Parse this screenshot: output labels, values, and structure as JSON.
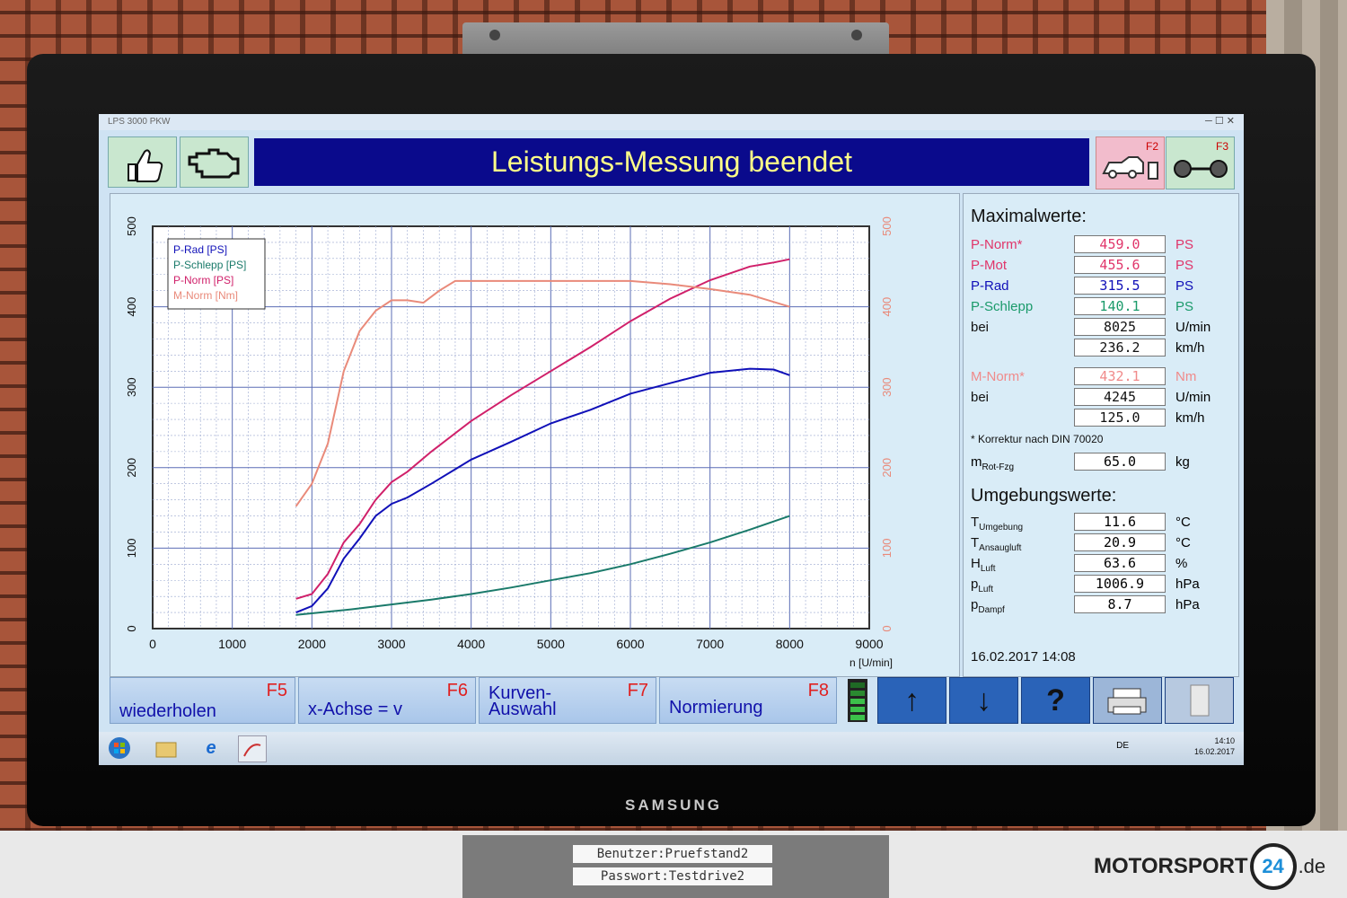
{
  "window": {
    "title": "LPS 3000 PKW",
    "controls": "─ ☐ ✕"
  },
  "header": {
    "title": "Leistungs-Messung beendet",
    "f2_label": "F2",
    "f3_label": "F3"
  },
  "chart_data": {
    "type": "line",
    "xlabel": "n [U/min]",
    "x_ticks": [
      "0",
      "1000",
      "2000",
      "3000",
      "4000",
      "5000",
      "6000",
      "7000",
      "8000",
      "9000"
    ],
    "y_left_ticks": [
      "0",
      "100",
      "200",
      "300",
      "400",
      "500"
    ],
    "y_right_ticks": [
      "0",
      "100",
      "200",
      "300",
      "400",
      "500"
    ],
    "xlim": [
      0,
      9000
    ],
    "ylim": [
      0,
      500
    ],
    "grid": true,
    "legend_position": "top-left",
    "series": [
      {
        "name": "P-Rad [PS]",
        "color": "#1010b8",
        "x": [
          1800,
          2000,
          2200,
          2400,
          2600,
          2800,
          3000,
          3200,
          3500,
          4000,
          4500,
          5000,
          5500,
          6000,
          6500,
          7000,
          7500,
          7800,
          8000
        ],
        "y": [
          20,
          28,
          50,
          87,
          112,
          140,
          155,
          163,
          180,
          210,
          232,
          255,
          272,
          292,
          305,
          318,
          323,
          322,
          315
        ]
      },
      {
        "name": "P-Schlepp [PS]",
        "color": "#1a7a6a",
        "x": [
          1800,
          2500,
          3000,
          3500,
          4000,
          4500,
          5000,
          5500,
          6000,
          6500,
          7000,
          7500,
          8000
        ],
        "y": [
          17,
          24,
          30,
          36,
          43,
          51,
          60,
          69,
          80,
          93,
          107,
          123,
          140
        ]
      },
      {
        "name": "P-Norm [PS]",
        "color": "#d0206a",
        "x": [
          1800,
          2000,
          2200,
          2400,
          2600,
          2800,
          3000,
          3200,
          3500,
          4000,
          4500,
          5000,
          5500,
          6000,
          6500,
          7000,
          7500,
          7800,
          8000
        ],
        "y": [
          37,
          43,
          68,
          107,
          130,
          160,
          182,
          195,
          220,
          258,
          290,
          320,
          350,
          382,
          410,
          433,
          450,
          455,
          459
        ]
      },
      {
        "name": "M-Norm [Nm]",
        "color": "#e98a7a",
        "x": [
          1800,
          2000,
          2200,
          2400,
          2600,
          2800,
          3000,
          3200,
          3400,
          3600,
          3800,
          4000,
          4500,
          5000,
          5500,
          6000,
          6500,
          7000,
          7500,
          8000
        ],
        "y": [
          152,
          180,
          230,
          320,
          370,
          395,
          408,
          408,
          405,
          420,
          432,
          432,
          432,
          432,
          432,
          432,
          428,
          422,
          415,
          400
        ]
      }
    ]
  },
  "maxima": {
    "heading": "Maximalwerte:",
    "rows": [
      {
        "label": "P-Norm*",
        "value": "459.0",
        "unit": "PS",
        "color": "#e0356a",
        "value_color": "#e0356a"
      },
      {
        "label": "P-Mot",
        "value": "455.6",
        "unit": "PS",
        "color": "#e0356a",
        "value_color": "#e0356a"
      },
      {
        "label": "P-Rad",
        "value": "315.5",
        "unit": "PS",
        "color": "#1010b8",
        "value_color": "#1010b8"
      },
      {
        "label": "P-Schlepp",
        "value": "140.1",
        "unit": "PS",
        "color": "#1a9a6a",
        "value_color": "#1a9a6a"
      },
      {
        "label": "bei",
        "value": "8025",
        "unit": "U/min",
        "color": "#111111",
        "value_color": "#111111"
      },
      {
        "label": "",
        "value": "236.2",
        "unit": "km/h",
        "color": "#111111",
        "value_color": "#111111"
      }
    ],
    "torque_rows": [
      {
        "label": "M-Norm*",
        "value": "432.1",
        "unit": "Nm",
        "color": "#f08a8a",
        "value_color": "#f08a8a"
      },
      {
        "label": "bei",
        "value": "4245",
        "unit": "U/min",
        "color": "#111111",
        "value_color": "#111111"
      },
      {
        "label": "",
        "value": "125.0",
        "unit": "km/h",
        "color": "#111111",
        "value_color": "#111111"
      }
    ],
    "note": "* Korrektur nach DIN 70020",
    "mass_label": "m",
    "mass_sub": "Rot-Fzg",
    "mass_value": "65.0",
    "mass_unit": "kg"
  },
  "ambient": {
    "heading": "Umgebungswerte:",
    "rows": [
      {
        "label": "T",
        "sub": "Umgebung",
        "value": "11.6",
        "unit": "°C"
      },
      {
        "label": "T",
        "sub": "Ansaugluft",
        "value": "20.9",
        "unit": "°C"
      },
      {
        "label": "H",
        "sub": "Luft",
        "value": "63.6",
        "unit": "%"
      },
      {
        "label": "p",
        "sub": "Luft",
        "value": "1006.9",
        "unit": "hPa"
      },
      {
        "label": "p",
        "sub": "Dampf",
        "value": "8.7",
        "unit": "hPa"
      }
    ],
    "timestamp": "16.02.2017   14:08"
  },
  "fbar": {
    "f5": {
      "key": "F5",
      "label": "wiederholen"
    },
    "f6": {
      "key": "F6",
      "label": "x-Achse = v"
    },
    "f7": {
      "key": "F7",
      "label1": "Kurven-",
      "label2": "Auswahl"
    },
    "f8": {
      "key": "F8",
      "label": "Normierung"
    },
    "up": "↑",
    "down": "↓",
    "help": "?"
  },
  "taskbar": {
    "lang": "DE",
    "time": "14:10",
    "date": "16.02.2017"
  },
  "monitor": {
    "brand": "SAMSUNG"
  },
  "overlay": {
    "user": "Benutzer:Pruefstand2",
    "password": "Passwort:Testdrive2",
    "logo_text": "MOTORSPORT",
    "logo_badge": "24",
    "logo_tld": ".de"
  }
}
